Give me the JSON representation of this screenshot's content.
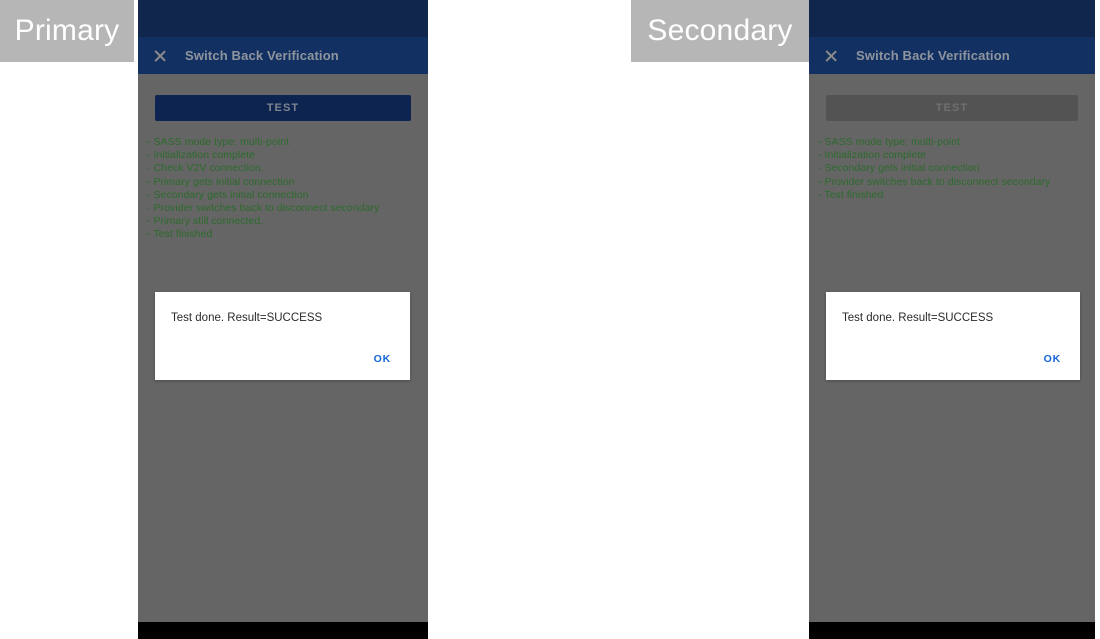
{
  "captions": {
    "primary": "Primary",
    "secondary": "Secondary"
  },
  "colors": {
    "status_bar": "#10264c",
    "app_bar": "#123162",
    "scrim": "#656565",
    "log_text": "#2c6b2c",
    "button_enabled": "#0d2350",
    "button_disabled": "#535353",
    "dialog_action": "#1565d8",
    "caption_background": "#b6b6b6",
    "nav_bar": "#000000"
  },
  "devices": {
    "primary": {
      "appbar": {
        "close_icon": "close-icon",
        "title": "Switch Back Verification"
      },
      "test_button": {
        "label": "TEST",
        "state": "enabled"
      },
      "log_lines": [
        "- SASS mode type: multi-point",
        "- Initialization complete",
        "- Check V2V connection.",
        "- Primary gets initial connection",
        "- Secondary gets initial connection",
        "- Provider switches back to disconnect secondary",
        "- Primary still connected.",
        "- Test finished"
      ],
      "dialog": {
        "message": "Test done. Result=SUCCESS",
        "ok_label": "OK"
      }
    },
    "secondary": {
      "appbar": {
        "close_icon": "close-icon",
        "title": "Switch Back Verification"
      },
      "test_button": {
        "label": "TEST",
        "state": "disabled"
      },
      "log_lines": [
        "- SASS mode type: multi-point",
        "- Initialization complete",
        "- Secondary gets initial connection",
        "- Provider switches back to disconnect secondary",
        "- Test finished"
      ],
      "dialog": {
        "message": "Test done. Result=SUCCESS",
        "ok_label": "OK"
      }
    }
  }
}
